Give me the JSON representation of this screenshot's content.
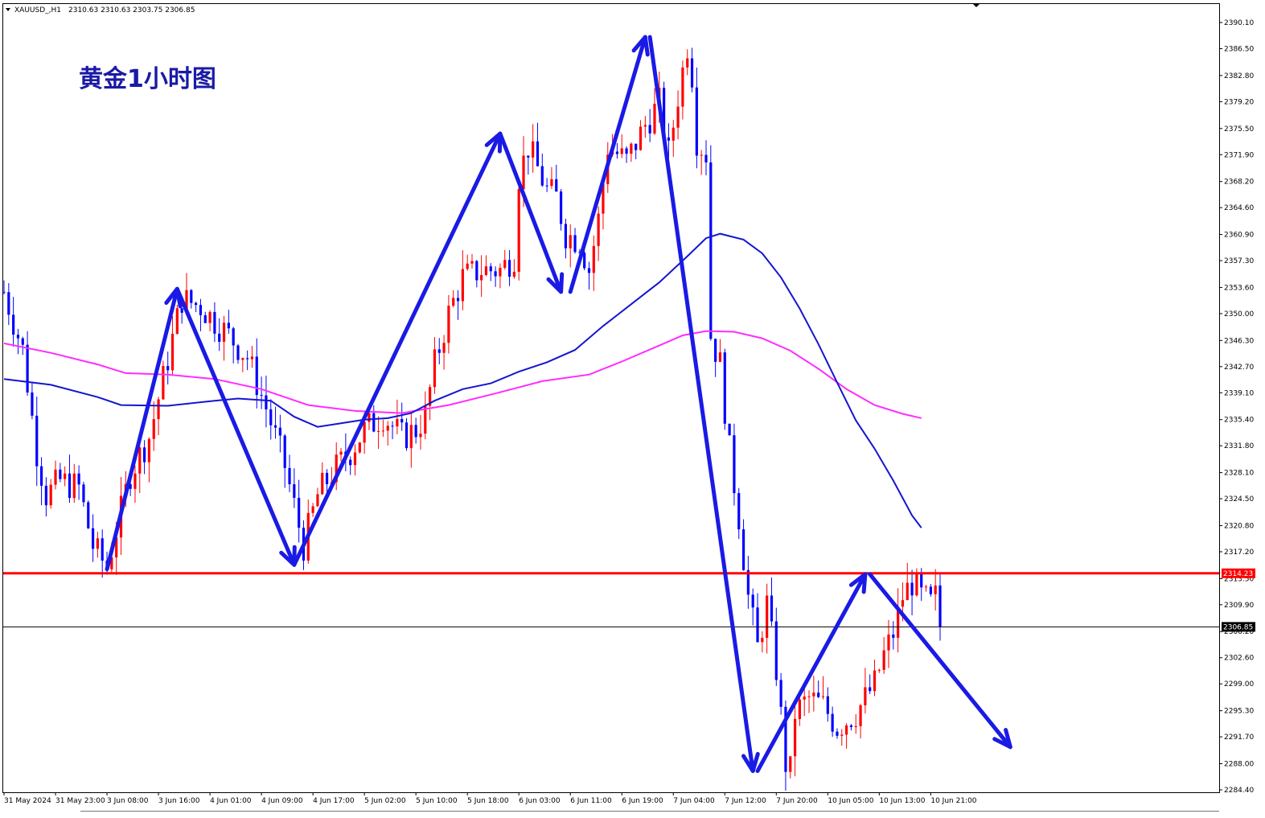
{
  "header": {
    "symbol": "XAUUSD_,H1",
    "ohlc": "2310.63 2310.63 2303.75 2306.85"
  },
  "chart_data": {
    "type": "candlestick",
    "title": "黄金1小时图",
    "ylim": [
      2282.7,
      2391.8
    ],
    "y_ticks": [
      "2390.10",
      "2386.50",
      "2382.80",
      "2379.20",
      "2375.50",
      "2371.90",
      "2368.20",
      "2364.60",
      "2360.90",
      "2357.30",
      "2353.60",
      "2350.00",
      "2346.30",
      "2342.70",
      "2339.10",
      "2335.40",
      "2331.80",
      "2328.10",
      "2324.50",
      "2320.80",
      "2317.20",
      "2313.50",
      "2309.90",
      "2306.20",
      "2302.60",
      "2299.00",
      "2295.30",
      "2291.70",
      "2288.00",
      "2284.40"
    ],
    "x_ticks": [
      {
        "label": "31 May 2024",
        "bar": 0
      },
      {
        "label": "31 May 23:00",
        "bar": 11
      },
      {
        "label": "3 Jun 08:00",
        "bar": 22
      },
      {
        "label": "3 Jun 16:00",
        "bar": 33
      },
      {
        "label": "4 Jun 01:00",
        "bar": 44
      },
      {
        "label": "4 Jun 09:00",
        "bar": 55
      },
      {
        "label": "4 Jun 17:00",
        "bar": 66
      },
      {
        "label": "5 Jun 02:00",
        "bar": 77
      },
      {
        "label": "5 Jun 10:00",
        "bar": 88
      },
      {
        "label": "5 Jun 18:00",
        "bar": 99
      },
      {
        "label": "6 Jun 03:00",
        "bar": 110
      },
      {
        "label": "6 Jun 11:00",
        "bar": 121
      },
      {
        "label": "6 Jun 19:00",
        "bar": 132
      },
      {
        "label": "7 Jun 04:00",
        "bar": 143
      },
      {
        "label": "7 Jun 12:00",
        "bar": 154
      },
      {
        "label": "7 Jun 20:00",
        "bar": 165
      },
      {
        "label": "10 Jun 05:00",
        "bar": 176
      },
      {
        "label": "10 Jun 13:00",
        "bar": 187
      },
      {
        "label": "10 Jun 21:00",
        "bar": 198
      }
    ],
    "horizontal_lines": [
      {
        "price": 2314.23,
        "label": "2314.23",
        "color": "#ff0000"
      },
      {
        "price": 2306.85,
        "label": "2306.85",
        "color": "#000000"
      }
    ],
    "close_path": [
      [
        0,
        2353
      ],
      [
        4,
        2345
      ],
      [
        7,
        2331
      ],
      [
        9,
        2325
      ],
      [
        12,
        2327
      ],
      [
        16,
        2326
      ],
      [
        19,
        2318
      ],
      [
        22,
        2315
      ],
      [
        27,
        2328
      ],
      [
        31,
        2333
      ],
      [
        34,
        2341
      ],
      [
        38,
        2352
      ],
      [
        42,
        2351
      ],
      [
        45,
        2349
      ],
      [
        48,
        2347
      ],
      [
        52,
        2344
      ],
      [
        56,
        2337
      ],
      [
        60,
        2329
      ],
      [
        64,
        2318
      ],
      [
        67,
        2325
      ],
      [
        70,
        2328
      ],
      [
        74,
        2331
      ],
      [
        77,
        2334
      ],
      [
        81,
        2336
      ],
      [
        85,
        2333
      ],
      [
        88,
        2334
      ],
      [
        90,
        2336
      ],
      [
        92,
        2343
      ],
      [
        95,
        2350
      ],
      [
        98,
        2355
      ],
      [
        102,
        2356
      ],
      [
        106,
        2356
      ],
      [
        109,
        2358
      ],
      [
        110,
        2369
      ],
      [
        112,
        2373
      ],
      [
        116,
        2367
      ],
      [
        118,
        2366
      ],
      [
        120,
        2361
      ],
      [
        123,
        2360
      ],
      [
        125,
        2356
      ],
      [
        127,
        2363
      ],
      [
        129,
        2373
      ],
      [
        133,
        2371
      ],
      [
        137,
        2376
      ],
      [
        140,
        2379
      ],
      [
        142,
        2372
      ],
      [
        144,
        2380
      ],
      [
        146,
        2387
      ],
      [
        147,
        2383
      ],
      [
        148,
        2374
      ],
      [
        150,
        2372
      ],
      [
        151,
        2347
      ],
      [
        153,
        2343
      ],
      [
        155,
        2331
      ],
      [
        157,
        2322
      ],
      [
        159,
        2311
      ],
      [
        161,
        2304
      ],
      [
        163,
        2310
      ],
      [
        165,
        2301
      ],
      [
        167,
        2288
      ],
      [
        168,
        2287
      ],
      [
        169,
        2295
      ],
      [
        172,
        2297
      ],
      [
        175,
        2296
      ],
      [
        178,
        2293
      ],
      [
        180,
        2294
      ],
      [
        182,
        2295
      ],
      [
        184,
        2297
      ],
      [
        186,
        2299
      ],
      [
        188,
        2303
      ],
      [
        190,
        2306
      ],
      [
        192,
        2311
      ],
      [
        194,
        2313
      ],
      [
        196,
        2311
      ],
      [
        198,
        2310
      ],
      [
        199,
        2311
      ],
      [
        200,
        2307
      ]
    ],
    "ma_blue": [
      [
        0,
        2341.0
      ],
      [
        10,
        2340.2
      ],
      [
        20,
        2338.5
      ],
      [
        25,
        2337.4
      ],
      [
        35,
        2337.3
      ],
      [
        45,
        2338.0
      ],
      [
        50,
        2338.3
      ],
      [
        57,
        2338.0
      ],
      [
        62,
        2335.8
      ],
      [
        67,
        2334.4
      ],
      [
        72,
        2334.9
      ],
      [
        77,
        2335.4
      ],
      [
        82,
        2335.6
      ],
      [
        87,
        2336.3
      ],
      [
        92,
        2338.0
      ],
      [
        98,
        2339.6
      ],
      [
        104,
        2340.4
      ],
      [
        110,
        2342.0
      ],
      [
        116,
        2343.3
      ],
      [
        122,
        2345.0
      ],
      [
        128,
        2348.3
      ],
      [
        134,
        2351.3
      ],
      [
        140,
        2354.3
      ],
      [
        146,
        2357.9
      ],
      [
        150,
        2360.4
      ],
      [
        153,
        2361.0
      ],
      [
        158,
        2360.2
      ],
      [
        162,
        2358.3
      ],
      [
        166,
        2355.0
      ],
      [
        170,
        2350.7
      ],
      [
        174,
        2345.8
      ],
      [
        178,
        2340.5
      ],
      [
        182,
        2335.3
      ],
      [
        186,
        2331.4
      ],
      [
        190,
        2327.0
      ],
      [
        194,
        2322.2
      ],
      [
        196,
        2320.5
      ]
    ],
    "ma_magenta": [
      [
        0,
        2345.9
      ],
      [
        10,
        2344.6
      ],
      [
        20,
        2343.0
      ],
      [
        26,
        2341.8
      ],
      [
        35,
        2341.6
      ],
      [
        45,
        2341.0
      ],
      [
        55,
        2339.6
      ],
      [
        65,
        2337.4
      ],
      [
        75,
        2336.6
      ],
      [
        85,
        2336.3
      ],
      [
        95,
        2337.4
      ],
      [
        105,
        2339.0
      ],
      [
        115,
        2340.7
      ],
      [
        125,
        2341.6
      ],
      [
        132,
        2343.4
      ],
      [
        140,
        2345.6
      ],
      [
        145,
        2347.0
      ],
      [
        150,
        2347.6
      ],
      [
        156,
        2347.5
      ],
      [
        162,
        2346.6
      ],
      [
        168,
        2344.9
      ],
      [
        174,
        2342.4
      ],
      [
        180,
        2339.6
      ],
      [
        186,
        2337.4
      ],
      [
        192,
        2336.2
      ],
      [
        196,
        2335.6
      ]
    ],
    "arrows": [
      [
        [
          22,
          2314.8
        ],
        [
          37,
          2353.4
        ]
      ],
      [
        [
          37,
          2353.4
        ],
        [
          62,
          2315.4
        ]
      ],
      [
        [
          62,
          2315.4
        ],
        [
          106,
          2374.8
        ]
      ],
      [
        [
          106,
          2374.8
        ],
        [
          119,
          2353.0
        ]
      ],
      [
        [
          121,
          2353.0
        ],
        [
          137,
          2388.1
        ]
      ],
      [
        [
          138,
          2388.1
        ],
        [
          160,
          2287.0
        ]
      ],
      [
        [
          161,
          2287.0
        ],
        [
          184,
          2314.1
        ]
      ],
      [
        [
          185,
          2314.1
        ],
        [
          215,
          2290.3
        ]
      ]
    ],
    "colors": {
      "up": "#ff0000",
      "down": "#0000ff",
      "arrow": "#1a1ae6",
      "ma_blue": "#1515d0",
      "ma_magenta": "#ff2cff"
    }
  }
}
